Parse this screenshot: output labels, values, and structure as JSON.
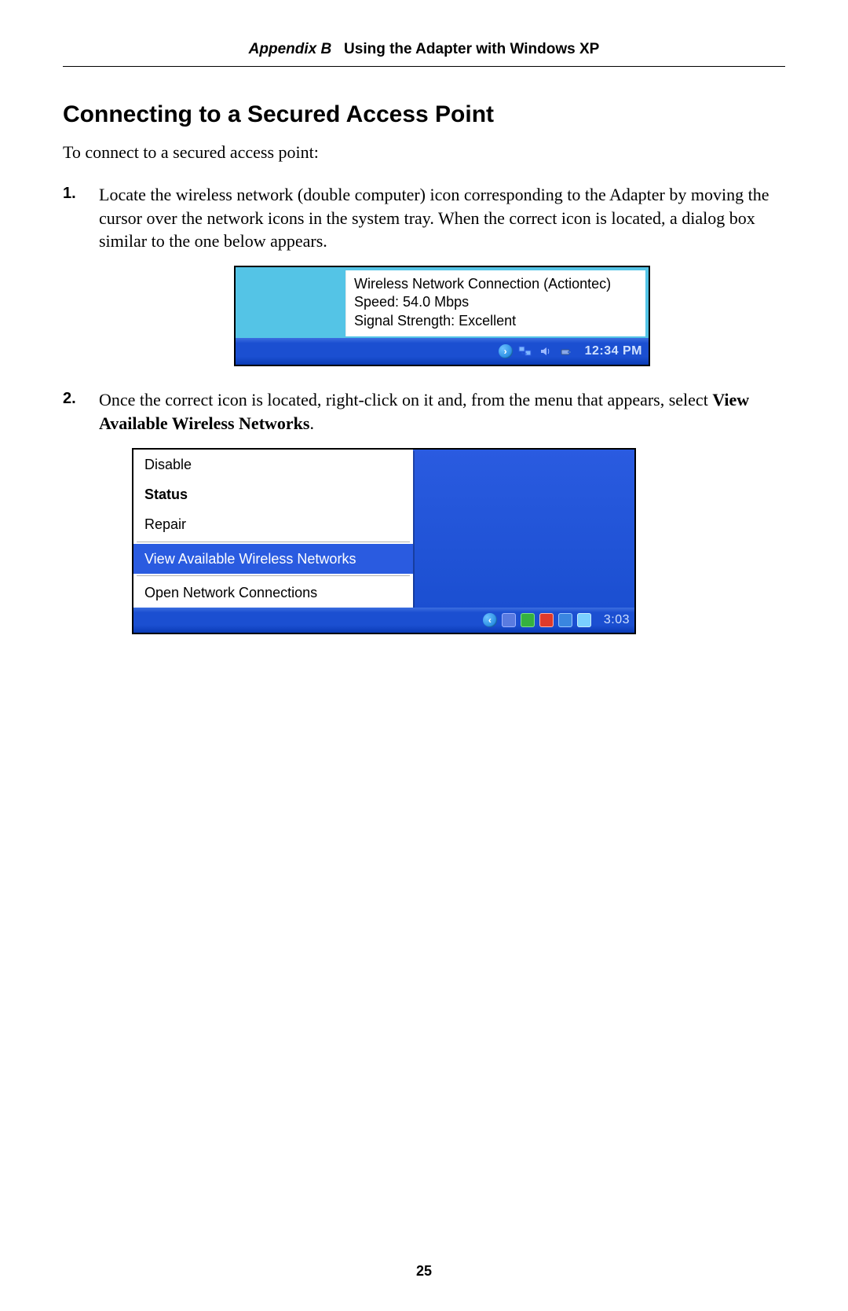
{
  "header": {
    "appendix_label": "Appendix B",
    "appendix_title": "Using the Adapter with Windows XP"
  },
  "section_title": "Connecting to a Secured Access Point",
  "intro": "To connect to a secured access point:",
  "steps": [
    {
      "text": "Locate the wireless network (double computer) icon corresponding to the Adapter by moving the cursor over the network icons in the system tray. When the correct icon is located, a dialog box similar to the one below appears."
    },
    {
      "text_pre": "Once the correct icon is located, right-click on it and, from the menu that appears, select ",
      "text_bold": "View Available Wireless Networks",
      "text_post": "."
    }
  ],
  "screenshot1": {
    "tooltip_line1": "Wireless Network Connection (Actiontec)",
    "tooltip_line2": "Speed: 54.0 Mbps",
    "tooltip_line3": "Signal Strength: Excellent",
    "tray_time": "12:34 PM"
  },
  "screenshot2": {
    "menu_items": {
      "disable": "Disable",
      "status": "Status",
      "repair": "Repair",
      "view_available": "View Available Wireless Networks",
      "open_connections": "Open Network Connections"
    },
    "tray_time": "3:03"
  },
  "page_number": "25"
}
